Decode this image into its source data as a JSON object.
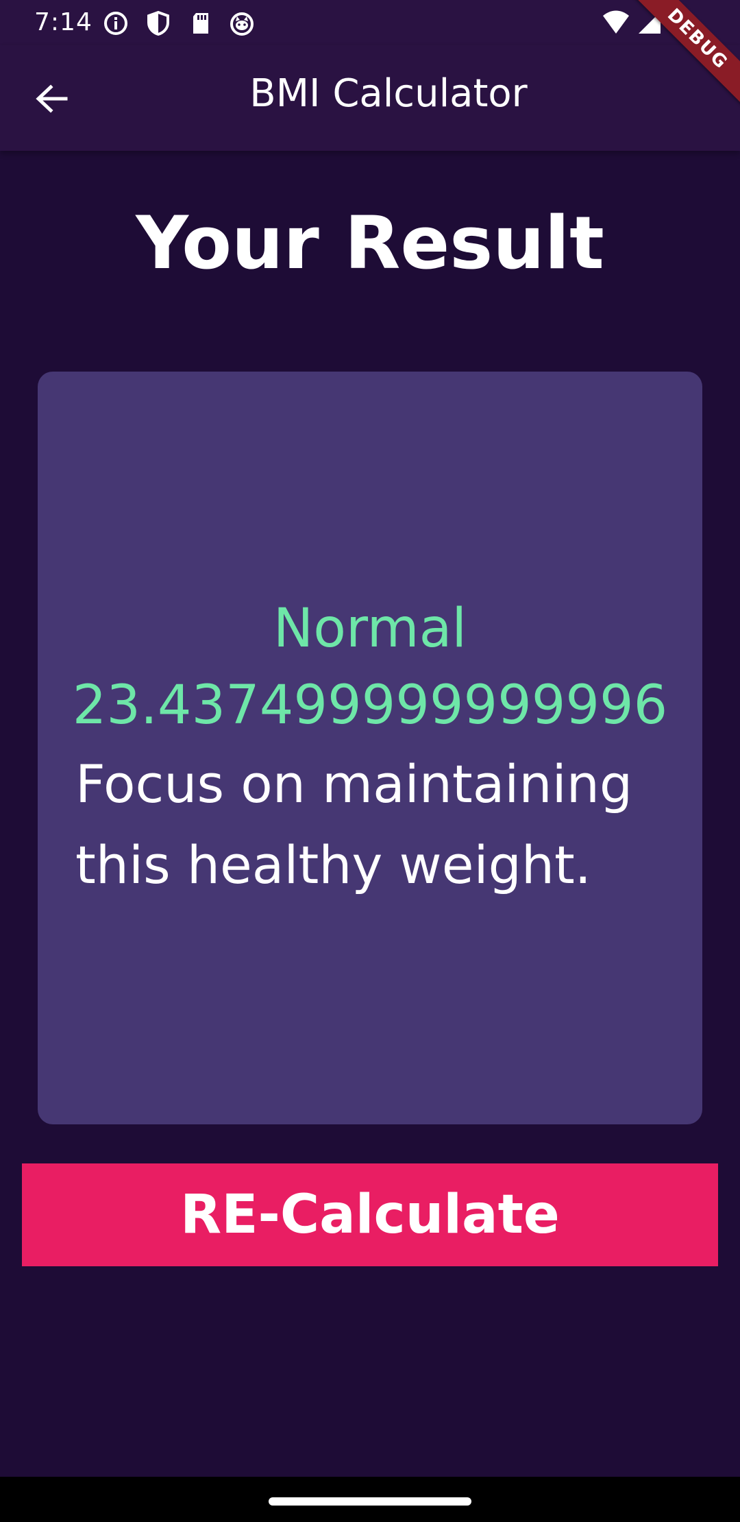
{
  "status_bar": {
    "time": "7:14",
    "icons": [
      "info-icon",
      "shield-icon",
      "sd-card-icon",
      "cat-icon",
      "wifi-icon",
      "signal-icon"
    ]
  },
  "app_bar": {
    "title": "BMI Calculator",
    "back_icon": "arrow-left-icon"
  },
  "debug_banner": "DEBUG",
  "page": {
    "heading": "Your Result"
  },
  "result": {
    "category": "Normal",
    "bmi": "23.437499999999996",
    "advice": "Focus on maintaining this healthy weight."
  },
  "actions": {
    "recalculate_label": "RE-Calculate"
  },
  "colors": {
    "background": "#1e0c36",
    "app_bar": "#2a1242",
    "card": "#463773",
    "result_text": "#6ee6a8",
    "button": "#e91e63"
  }
}
